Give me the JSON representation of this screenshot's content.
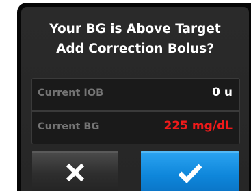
{
  "dialog": {
    "title_line1": "Your BG is Above Target",
    "title_line2": "Add Correction Bolus?"
  },
  "rows": [
    {
      "label": "Current IOB",
      "value": "0 u"
    },
    {
      "label": "Current BG",
      "value": "225 mg/dL"
    }
  ],
  "buttons": {
    "cancel_icon": "close-icon",
    "confirm_icon": "checkmark-icon"
  },
  "colors": {
    "background": "#060606",
    "dialog": "#2a2a2a",
    "label_text": "#747474",
    "value_text": "#ffffff",
    "alert_value": "#f01a1a",
    "confirm_button": "#1e93e6"
  }
}
